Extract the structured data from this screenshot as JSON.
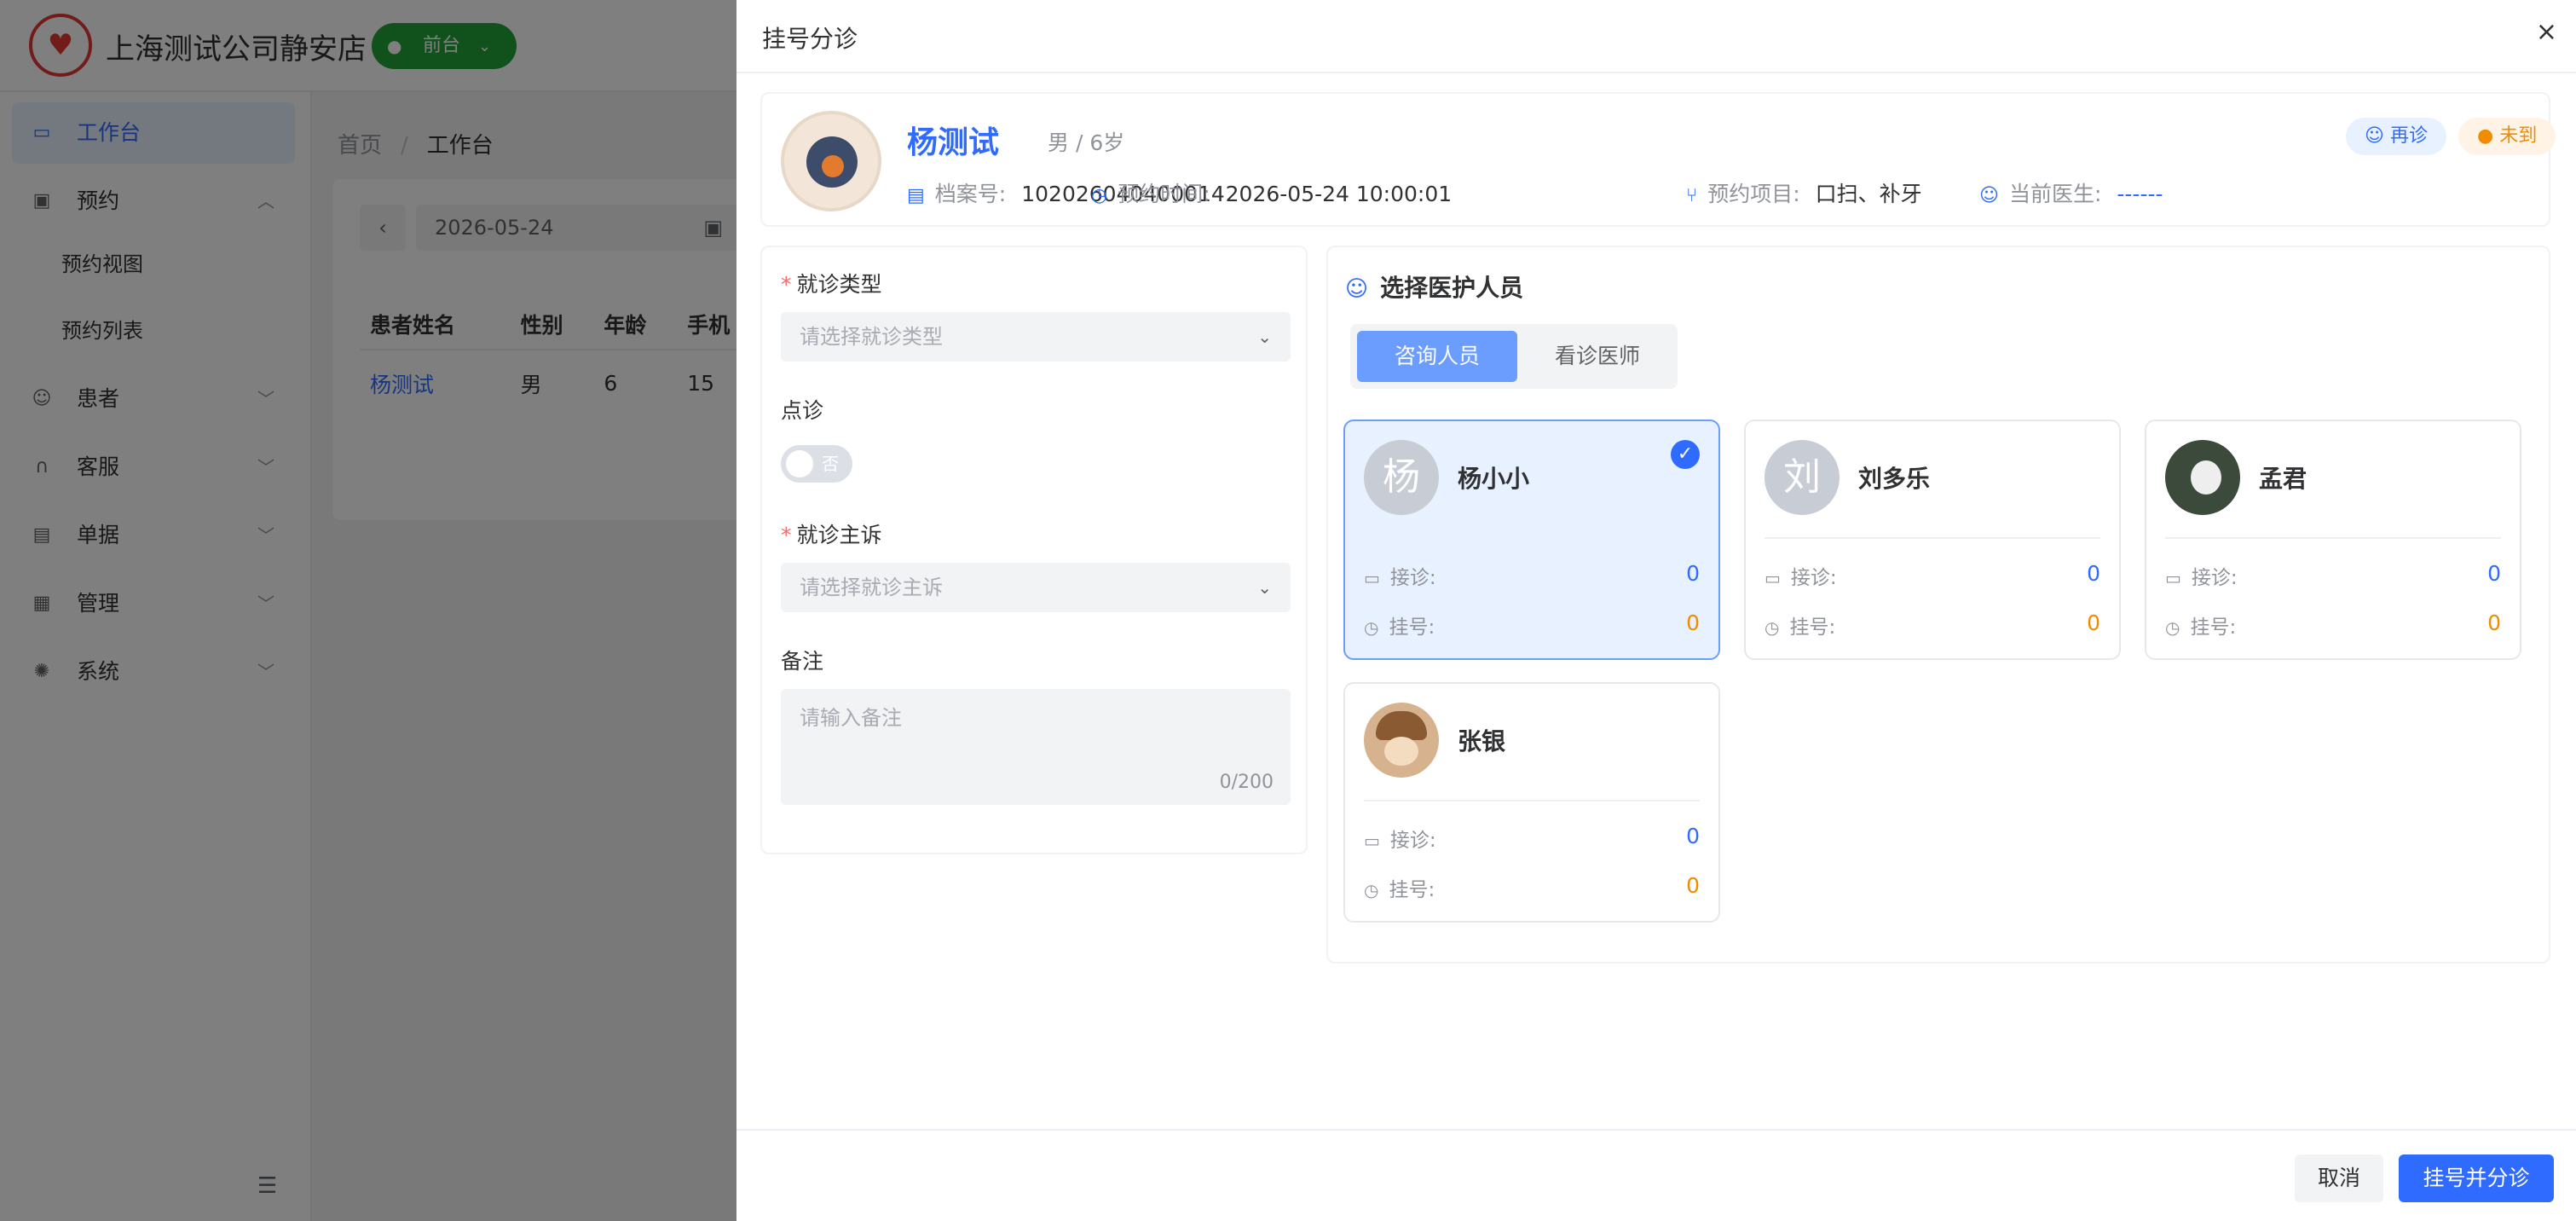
{
  "topbar": {
    "company": "上海测试公司静安店",
    "role": "前台"
  },
  "sidebar": {
    "items": [
      {
        "label": "工作台",
        "icon": "monitor-icon"
      },
      {
        "label": "预约",
        "icon": "calendar-icon"
      },
      {
        "label": "预约视图"
      },
      {
        "label": "预约列表"
      },
      {
        "label": "患者",
        "icon": "patient-icon"
      },
      {
        "label": "客服",
        "icon": "headset-icon"
      },
      {
        "label": "单据",
        "icon": "document-icon"
      },
      {
        "label": "管理",
        "icon": "grid-icon"
      },
      {
        "label": "系统",
        "icon": "settings-icon"
      }
    ]
  },
  "breadcrumb": {
    "home": "首页",
    "separator": "/",
    "current": "工作台"
  },
  "background_content": {
    "date": "2026-05-24",
    "table_headers": [
      "患者姓名",
      "性别",
      "年龄",
      "手机"
    ],
    "rows": [
      [
        "杨测试",
        "男",
        "6",
        "15"
      ]
    ]
  },
  "drawer": {
    "title": "挂号分诊",
    "close": "×"
  },
  "patient": {
    "name": "杨测试",
    "meta": "男 / 6岁",
    "record_label": "档案号:",
    "record_no": "102026040400014",
    "time_label": "预约时间:",
    "time": "2026-05-24 10:00:01",
    "project_label": "预约项目:",
    "project": "口扫、补牙",
    "doctor_label": "当前医生:",
    "doctor": "------",
    "tag_revisit": "再诊",
    "tag_absent": "未到",
    "colors": {
      "accent": "#2f6bff",
      "warning": "#f08c00"
    }
  },
  "form": {
    "visit_type_label": "就诊类型",
    "visit_type_placeholder": "请选择就诊类型",
    "designated_label": "点诊",
    "designated_state": "否",
    "complaint_label": "就诊主诉",
    "complaint_placeholder": "请选择就诊主诉",
    "remark_label": "备注",
    "remark_placeholder": "请输入备注",
    "remark_count": "0/200"
  },
  "staff": {
    "title": "选择医护人员",
    "tabs": [
      "咨询人员",
      "看诊医师"
    ],
    "reception_label": "接诊:",
    "register_label": "挂号:",
    "cards": [
      {
        "avatar_text": "杨",
        "name": "杨小小",
        "reception": "0",
        "register": "0",
        "selected": true
      },
      {
        "avatar_text": "刘",
        "name": "刘多乐",
        "reception": "0",
        "register": "0",
        "selected": false
      },
      {
        "avatar_text": "",
        "name": "孟君",
        "reception": "0",
        "register": "0",
        "selected": false
      },
      {
        "avatar_text": "",
        "name": "张银",
        "reception": "0",
        "register": "0",
        "selected": false
      }
    ]
  },
  "footer": {
    "cancel": "取消",
    "confirm": "挂号并分诊"
  }
}
